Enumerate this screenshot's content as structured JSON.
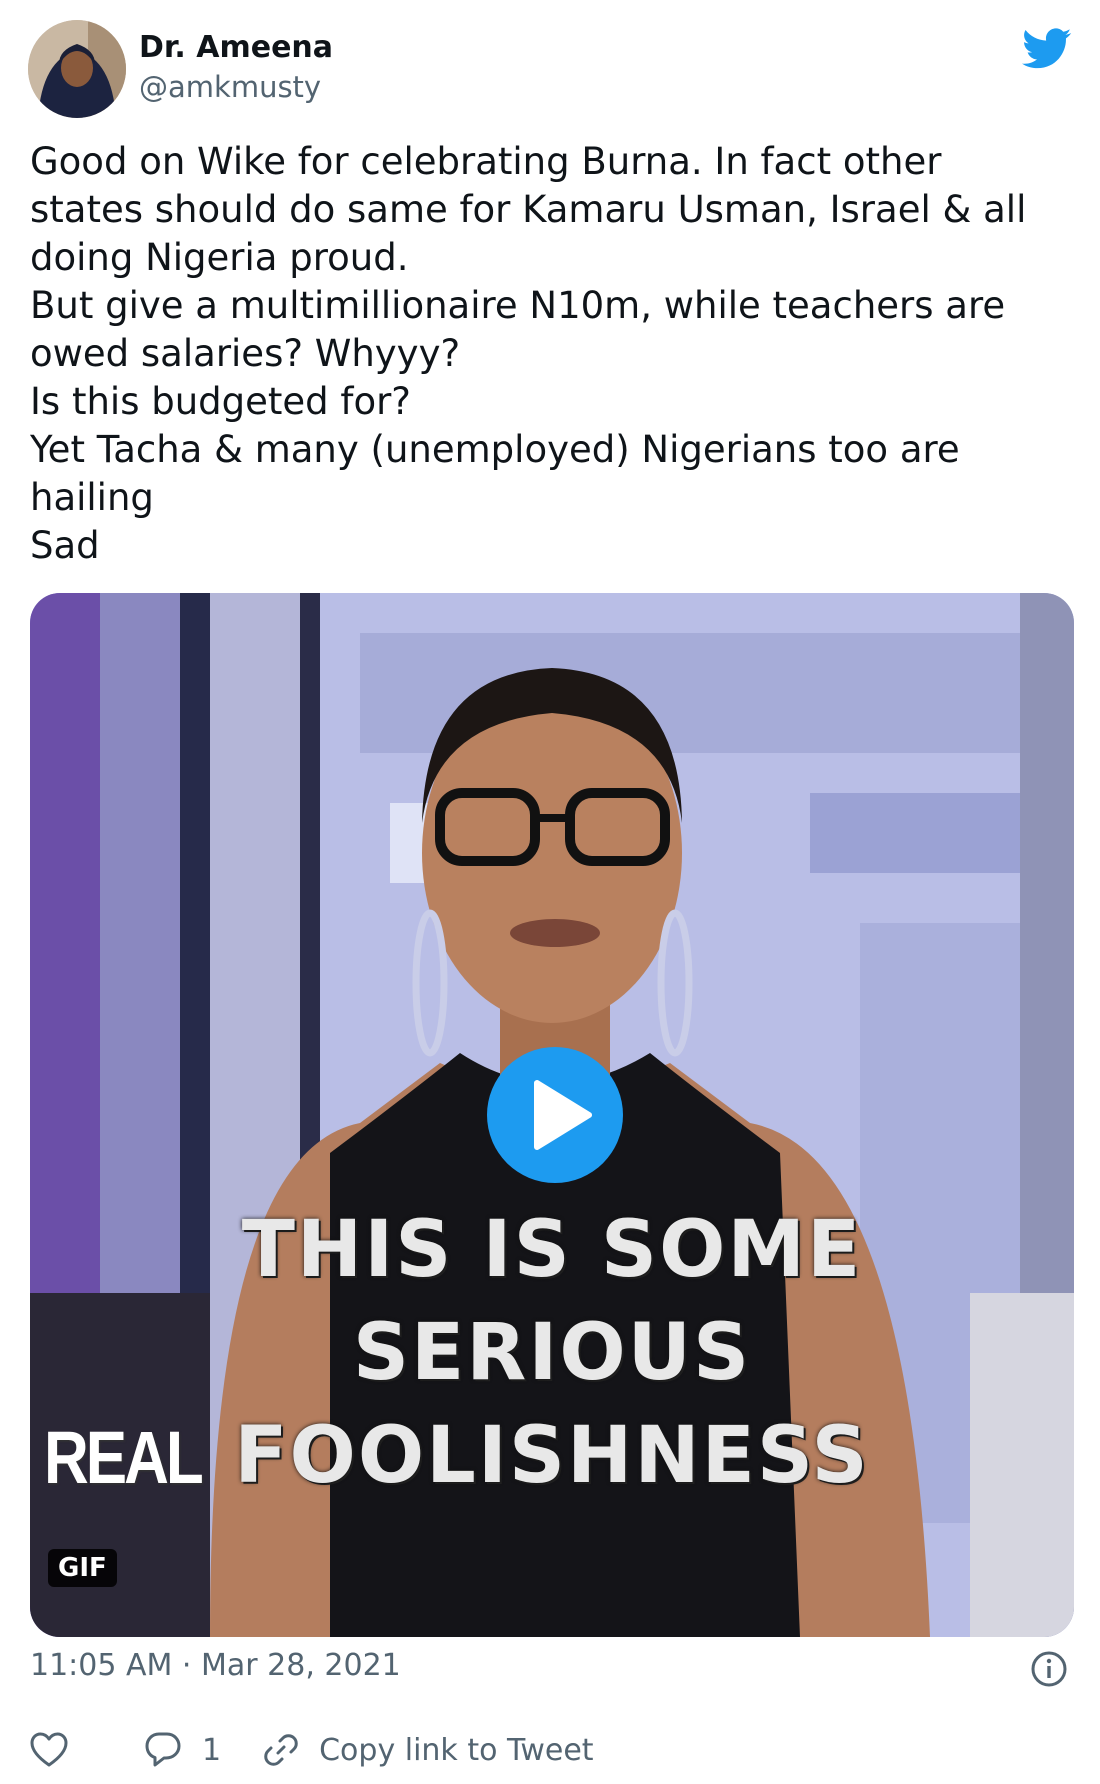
{
  "author": {
    "display_name": "Dr. Ameena",
    "handle": "@amkmusty"
  },
  "tweet": {
    "lines": [
      "Good on Wike for celebrating Burna. In fact other",
      "states should do same for Kamaru Usman, Israel & all",
      "doing Nigeria proud.",
      "But give a multimillionaire N10m, while teachers are",
      "owed salaries? Whyyy?",
      "Is this budgeted for?",
      "Yet Tacha & many (unemployed) Nigerians too are",
      "hailing",
      "Sad"
    ],
    "timestamp": "11:05 AM · Mar 28, 2021"
  },
  "media": {
    "type_badge": "GIF",
    "caption_lines": [
      "THIS IS SOME",
      "SERIOUS",
      "FOOLISHNESS"
    ],
    "logo_text": "REAL"
  },
  "actions": {
    "reply_count": "1",
    "copy_link_label": "Copy link to Tweet"
  },
  "icons": {
    "brand": "twitter-bird-icon",
    "play": "play-icon",
    "info": "info-icon",
    "like": "heart-icon",
    "reply": "reply-bubble-icon",
    "link": "link-icon"
  },
  "colors": {
    "brand_blue": "#1d9bf0",
    "secondary_text": "#536471",
    "primary_text": "#0f1419"
  }
}
